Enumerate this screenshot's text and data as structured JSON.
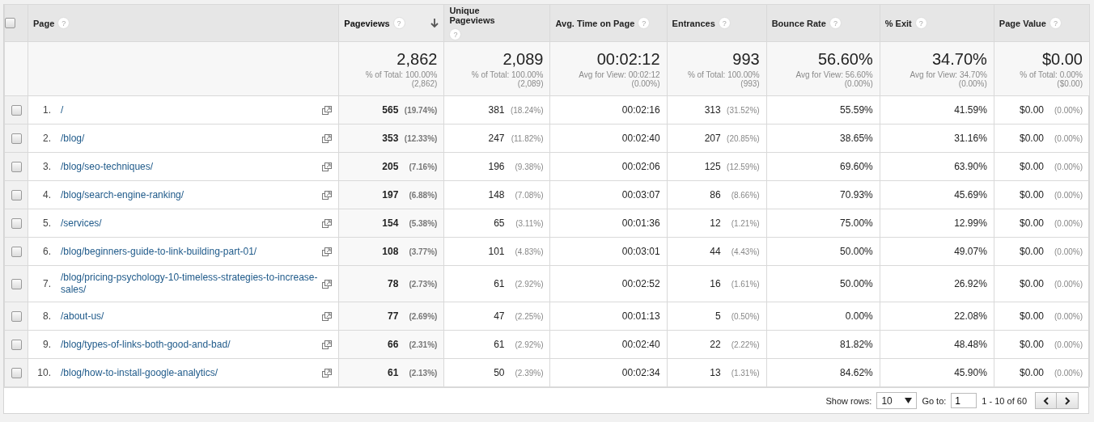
{
  "table": {
    "all_checked": false,
    "columns": [
      {
        "label": "Page",
        "help": "?",
        "sorted": false
      },
      {
        "label": "Pageviews",
        "help": "?",
        "sorted": true
      },
      {
        "label": "Unique Pageviews",
        "help": "?",
        "sorted": false
      },
      {
        "label": "Avg. Time on Page",
        "help": "?",
        "sorted": false
      },
      {
        "label": "Entrances",
        "help": "?",
        "sorted": false
      },
      {
        "label": "Bounce Rate",
        "help": "?",
        "sorted": false
      },
      {
        "label": "% Exit",
        "help": "?",
        "sorted": false
      },
      {
        "label": "Page Value",
        "help": "?",
        "sorted": false
      }
    ],
    "totals": [
      {
        "value": "2,862",
        "caption": "% of Total: 100.00%",
        "detail": "(2,862)"
      },
      {
        "value": "2,089",
        "caption": "% of Total: 100.00%",
        "detail": "(2,089)"
      },
      {
        "value": "00:02:12",
        "caption": "Avg for View: 00:02:12",
        "detail": "(0.00%)"
      },
      {
        "value": "993",
        "caption": "% of Total: 100.00%",
        "detail": "(993)"
      },
      {
        "value": "56.60%",
        "caption": "Avg for View: 56.60%",
        "detail": "(0.00%)"
      },
      {
        "value": "34.70%",
        "caption": "Avg for View: 34.70%",
        "detail": "(0.00%)"
      },
      {
        "value": "$0.00",
        "caption": "% of Total: 0.00%",
        "detail": "($0.00)"
      }
    ],
    "rows": [
      {
        "checked": false,
        "cells": [
          {
            "number": "1.",
            "path": "/"
          },
          {
            "value": "565",
            "share": "(19.74%)"
          },
          {
            "value": "381",
            "share": "(18.24%)"
          },
          {
            "value": "00:02:16"
          },
          {
            "value": "313",
            "share": "(31.52%)"
          },
          {
            "value": "55.59%"
          },
          {
            "value": "41.59%"
          },
          {
            "value": "$0.00",
            "share": "(0.00%)"
          }
        ]
      },
      {
        "checked": false,
        "cells": [
          {
            "number": "2.",
            "path": "/blog/"
          },
          {
            "value": "353",
            "share": "(12.33%)"
          },
          {
            "value": "247",
            "share": "(11.82%)"
          },
          {
            "value": "00:02:40"
          },
          {
            "value": "207",
            "share": "(20.85%)"
          },
          {
            "value": "38.65%"
          },
          {
            "value": "31.16%"
          },
          {
            "value": "$0.00",
            "share": "(0.00%)"
          }
        ]
      },
      {
        "checked": false,
        "cells": [
          {
            "number": "3.",
            "path": "/blog/seo-techniques/"
          },
          {
            "value": "205",
            "share": "(7.16%)"
          },
          {
            "value": "196",
            "share": "(9.38%)"
          },
          {
            "value": "00:02:06"
          },
          {
            "value": "125",
            "share": "(12.59%)"
          },
          {
            "value": "69.60%"
          },
          {
            "value": "63.90%"
          },
          {
            "value": "$0.00",
            "share": "(0.00%)"
          }
        ]
      },
      {
        "checked": false,
        "cells": [
          {
            "number": "4.",
            "path": "/blog/search-engine-ranking/"
          },
          {
            "value": "197",
            "share": "(6.88%)"
          },
          {
            "value": "148",
            "share": "(7.08%)"
          },
          {
            "value": "00:03:07"
          },
          {
            "value": "86",
            "share": "(8.66%)"
          },
          {
            "value": "70.93%"
          },
          {
            "value": "45.69%"
          },
          {
            "value": "$0.00",
            "share": "(0.00%)"
          }
        ]
      },
      {
        "checked": false,
        "cells": [
          {
            "number": "5.",
            "path": "/services/"
          },
          {
            "value": "154",
            "share": "(5.38%)"
          },
          {
            "value": "65",
            "share": "(3.11%)"
          },
          {
            "value": "00:01:36"
          },
          {
            "value": "12",
            "share": "(1.21%)"
          },
          {
            "value": "75.00%"
          },
          {
            "value": "12.99%"
          },
          {
            "value": "$0.00",
            "share": "(0.00%)"
          }
        ]
      },
      {
        "checked": false,
        "cells": [
          {
            "number": "6.",
            "path": "/blog/beginners-guide-to-link-building-part-01/"
          },
          {
            "value": "108",
            "share": "(3.77%)"
          },
          {
            "value": "101",
            "share": "(4.83%)"
          },
          {
            "value": "00:03:01"
          },
          {
            "value": "44",
            "share": "(4.43%)"
          },
          {
            "value": "50.00%"
          },
          {
            "value": "49.07%"
          },
          {
            "value": "$0.00",
            "share": "(0.00%)"
          }
        ]
      },
      {
        "checked": false,
        "cells": [
          {
            "number": "7.",
            "path": "/blog/pricing-psychology-10-timeless-strategies-to-increase-sales/"
          },
          {
            "value": "78",
            "share": "(2.73%)"
          },
          {
            "value": "61",
            "share": "(2.92%)"
          },
          {
            "value": "00:02:52"
          },
          {
            "value": "16",
            "share": "(1.61%)"
          },
          {
            "value": "50.00%"
          },
          {
            "value": "26.92%"
          },
          {
            "value": "$0.00",
            "share": "(0.00%)"
          }
        ]
      },
      {
        "checked": false,
        "cells": [
          {
            "number": "8.",
            "path": "/about-us/"
          },
          {
            "value": "77",
            "share": "(2.69%)"
          },
          {
            "value": "47",
            "share": "(2.25%)"
          },
          {
            "value": "00:01:13"
          },
          {
            "value": "5",
            "share": "(0.50%)"
          },
          {
            "value": "0.00%"
          },
          {
            "value": "22.08%"
          },
          {
            "value": "$0.00",
            "share": "(0.00%)"
          }
        ]
      },
      {
        "checked": false,
        "cells": [
          {
            "number": "9.",
            "path": "/blog/types-of-links-both-good-and-bad/"
          },
          {
            "value": "66",
            "share": "(2.31%)"
          },
          {
            "value": "61",
            "share": "(2.92%)"
          },
          {
            "value": "00:02:40"
          },
          {
            "value": "22",
            "share": "(2.22%)"
          },
          {
            "value": "81.82%"
          },
          {
            "value": "48.48%"
          },
          {
            "value": "$0.00",
            "share": "(0.00%)"
          }
        ]
      },
      {
        "checked": false,
        "cells": [
          {
            "number": "10.",
            "path": "/blog/how-to-install-google-analytics/"
          },
          {
            "value": "61",
            "share": "(2.13%)"
          },
          {
            "value": "50",
            "share": "(2.39%)"
          },
          {
            "value": "00:02:34"
          },
          {
            "value": "13",
            "share": "(1.31%)"
          },
          {
            "value": "84.62%"
          },
          {
            "value": "45.90%"
          },
          {
            "value": "$0.00",
            "share": "(0.00%)"
          }
        ]
      }
    ]
  },
  "footer": {
    "show_rows_label": "Show rows:",
    "show_rows_value": "10",
    "goto_label": "Go to:",
    "goto_value": "1",
    "range": "1 - 10 of 60"
  }
}
